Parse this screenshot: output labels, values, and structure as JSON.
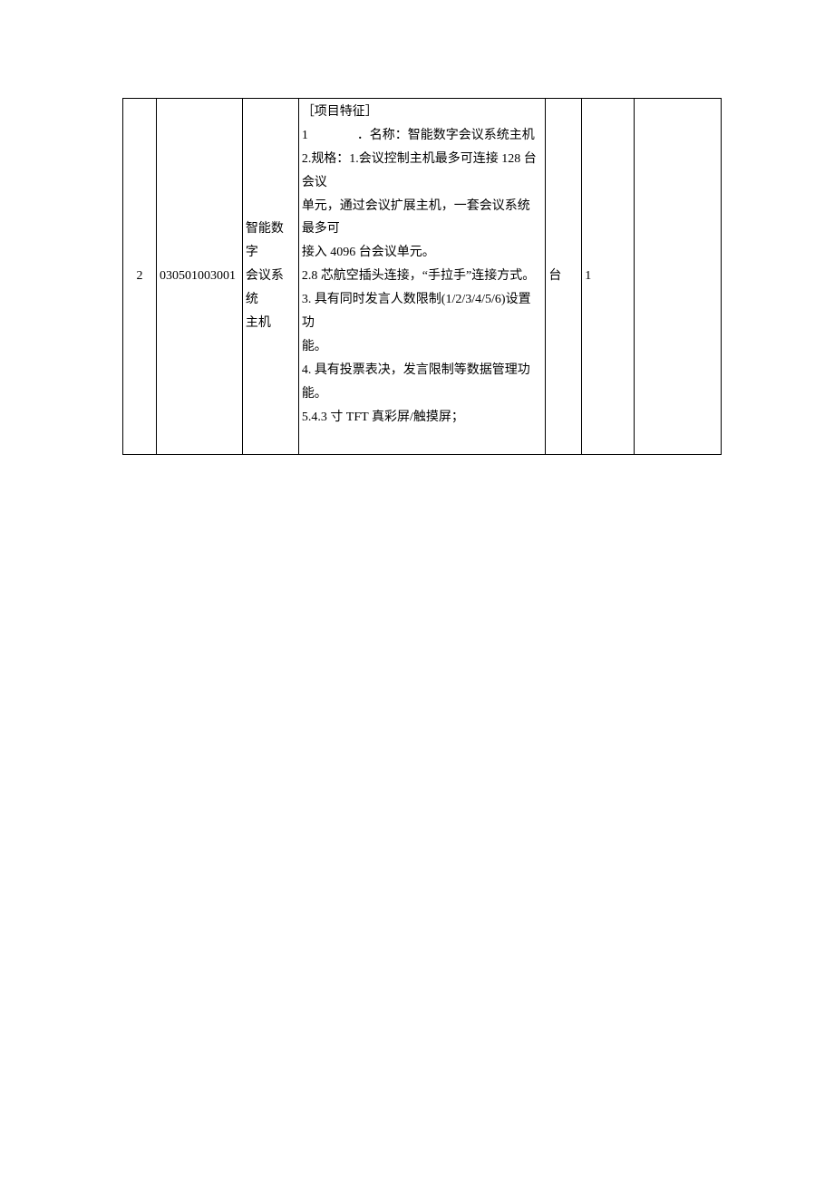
{
  "table": {
    "row": {
      "seq": "2",
      "code": "030501003001",
      "name_line1": "智能数字",
      "name_line2": "会议系统",
      "name_line3": "主机",
      "desc_header": "［项目特征］",
      "desc_line1_prefix": "1",
      "desc_line1_rest": "．名称：智能数字会议系统主机",
      "desc_line2": "2.规格：1.会议控制主机最多可连接 128 台会议",
      "desc_line3": "单元，通过会议扩展主机，一套会议系统最多可",
      "desc_line4": "接入 4096 台会议单元。",
      "desc_line5": "2.8 芯航空插头连接，“手拉手”连接方式。",
      "desc_line6": "3. 具有同时发言人数限制(1/2/3/4/5/6)设置功",
      "desc_line7": "能。",
      "desc_line8": "4. 具有投票表决，发言限制等数据管理功能。",
      "desc_line9": "5.4.3 寸 TFT 真彩屏/触摸屏；",
      "unit": "台",
      "qty": "1"
    }
  }
}
